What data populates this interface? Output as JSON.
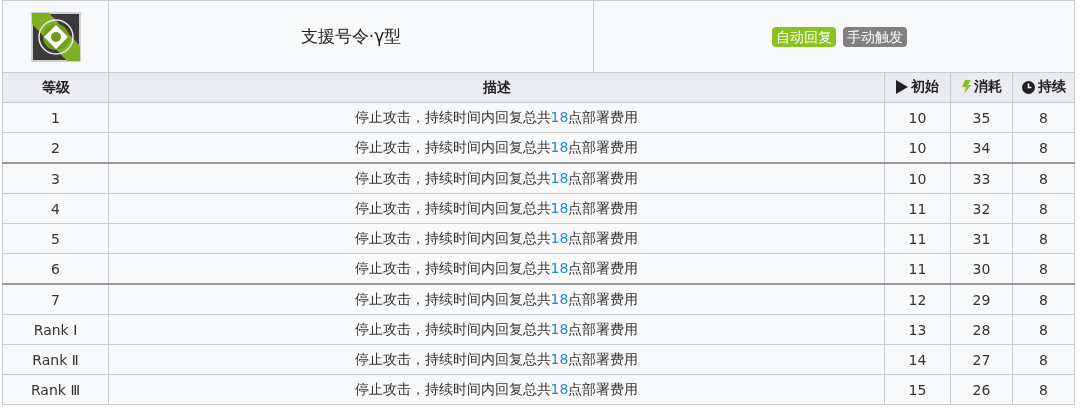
{
  "skill": {
    "name": "支援号令·γ型",
    "tags": [
      {
        "label": "自动回复",
        "color": "#8cc21f"
      },
      {
        "label": "手动触发",
        "color": "#808080"
      }
    ]
  },
  "table": {
    "columns": [
      {
        "label": "等级",
        "kind": "plain"
      },
      {
        "label": "描述",
        "kind": "plain"
      },
      {
        "label": "初始",
        "kind": "play"
      },
      {
        "label": "消耗",
        "kind": "bolt"
      },
      {
        "label": "持续",
        "kind": "clock"
      }
    ],
    "rows": [
      {
        "level": "1",
        "description": {
          "before": "停止攻击，持续时间内回复总共",
          "number": "18",
          "after": "点部署费用"
        },
        "initial": "10",
        "cost": "35",
        "duration": "8",
        "divider_above": false
      },
      {
        "level": "2",
        "description": {
          "before": "停止攻击，持续时间内回复总共",
          "number": "18",
          "after": "点部署费用"
        },
        "initial": "10",
        "cost": "34",
        "duration": "8",
        "divider_above": false
      },
      {
        "level": "3",
        "description": {
          "before": "停止攻击，持续时间内回复总共",
          "number": "18",
          "after": "点部署费用"
        },
        "initial": "10",
        "cost": "33",
        "duration": "8",
        "divider_above": true
      },
      {
        "level": "4",
        "description": {
          "before": "停止攻击，持续时间内回复总共",
          "number": "18",
          "after": "点部署费用"
        },
        "initial": "11",
        "cost": "32",
        "duration": "8",
        "divider_above": false
      },
      {
        "level": "5",
        "description": {
          "before": "停止攻击，持续时间内回复总共",
          "number": "18",
          "after": "点部署费用"
        },
        "initial": "11",
        "cost": "31",
        "duration": "8",
        "divider_above": false
      },
      {
        "level": "6",
        "description": {
          "before": "停止攻击，持续时间内回复总共",
          "number": "18",
          "after": "点部署费用"
        },
        "initial": "11",
        "cost": "30",
        "duration": "8",
        "divider_above": false
      },
      {
        "level": "7",
        "description": {
          "before": "停止攻击，持续时间内回复总共",
          "number": "18",
          "after": "点部署费用"
        },
        "initial": "12",
        "cost": "29",
        "duration": "8",
        "divider_above": true
      },
      {
        "level": "Rank Ⅰ",
        "description": {
          "before": "停止攻击，持续时间内回复总共",
          "number": "18",
          "after": "点部署费用"
        },
        "initial": "13",
        "cost": "28",
        "duration": "8",
        "divider_above": false
      },
      {
        "level": "Rank Ⅱ",
        "description": {
          "before": "停止攻击，持续时间内回复总共",
          "number": "18",
          "after": "点部署费用"
        },
        "initial": "14",
        "cost": "27",
        "duration": "8",
        "divider_above": false
      },
      {
        "level": "Rank Ⅲ",
        "description": {
          "before": "停止攻击，持续时间内回复总共",
          "number": "18",
          "after": "点部署费用"
        },
        "initial": "15",
        "cost": "26",
        "duration": "8",
        "divider_above": false
      }
    ]
  }
}
